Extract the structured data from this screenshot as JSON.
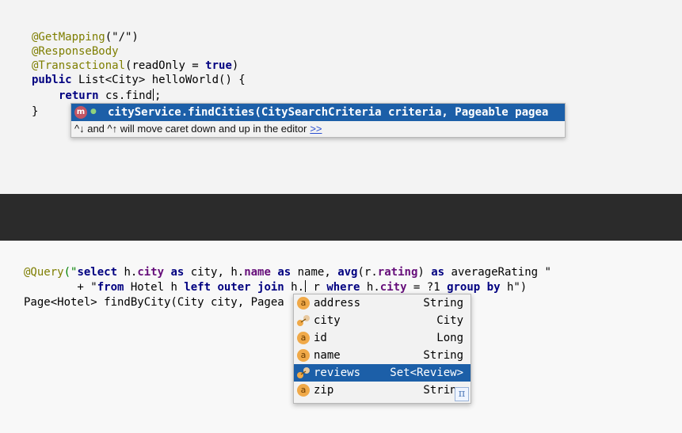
{
  "top": {
    "line1": "@GetMapping",
    "line1_arg": "(\"/\")",
    "line2": "@ResponseBody",
    "line3_anno": "@Transactional",
    "line3_rest": "(readOnly = ",
    "line3_true": "true",
    "line3_end": ")",
    "line4_kw": "public",
    "line4_rest": " List<City> helloWorld() {",
    "line5_kw": "return",
    "line5_rest": " cs.find",
    "line5_end": ";",
    "line6": "}",
    "completion": {
      "item_icon": "method-icon",
      "item_icon_letter": "m",
      "item_text": "cityService.findCities(CitySearchCriteria criteria, Pageable pagea",
      "hint_text": "^↓ and ^↑ will move caret down and up in the editor",
      "hint_link": ">>"
    }
  },
  "bottom": {
    "q_anno": "@Query",
    "q_open": "(\"",
    "q_p1": "select",
    "q_p2": " h.",
    "q_p3": "city",
    "q_p4": " as ",
    "q_p5": "city, h.",
    "q_p6": "name",
    "q_p7": " as ",
    "q_p8": "name, ",
    "q_p9": "avg",
    "q_p10": "(r.",
    "q_p11": "rating",
    "q_p12": ") ",
    "q_p13": "as",
    "q_p14": " averageRating \"",
    "l2_plus": "        + \"",
    "l2_p1": "from",
    "l2_p2": " Hotel h ",
    "l2_p3": "left outer join",
    "l2_p4": " h.",
    "l2_p5": " r ",
    "l2_p6": "where",
    "l2_p7": " h.",
    "l2_p8": "city",
    "l2_p9": " = ?1 ",
    "l2_p10": "group by",
    "l2_p11": " h\")",
    "l3": "Page<Hotel> findByCity(City city, Pagea",
    "fields": [
      {
        "icon": "field-icon",
        "letter": "a",
        "name": "address",
        "type": "String",
        "selected": false
      },
      {
        "icon": "relation-icon",
        "letter": "",
        "name": "city",
        "type": "City",
        "selected": false
      },
      {
        "icon": "field-icon",
        "letter": "a",
        "name": "id",
        "type": "Long",
        "selected": false
      },
      {
        "icon": "field-icon",
        "letter": "a",
        "name": "name",
        "type": "String",
        "selected": false
      },
      {
        "icon": "relation-icon",
        "letter": "",
        "name": "reviews",
        "type": "Set<Review>",
        "selected": true
      },
      {
        "icon": "field-icon",
        "letter": "a",
        "name": "zip",
        "type": "Strin–",
        "selected": false
      }
    ],
    "pi_symbol": "π"
  }
}
